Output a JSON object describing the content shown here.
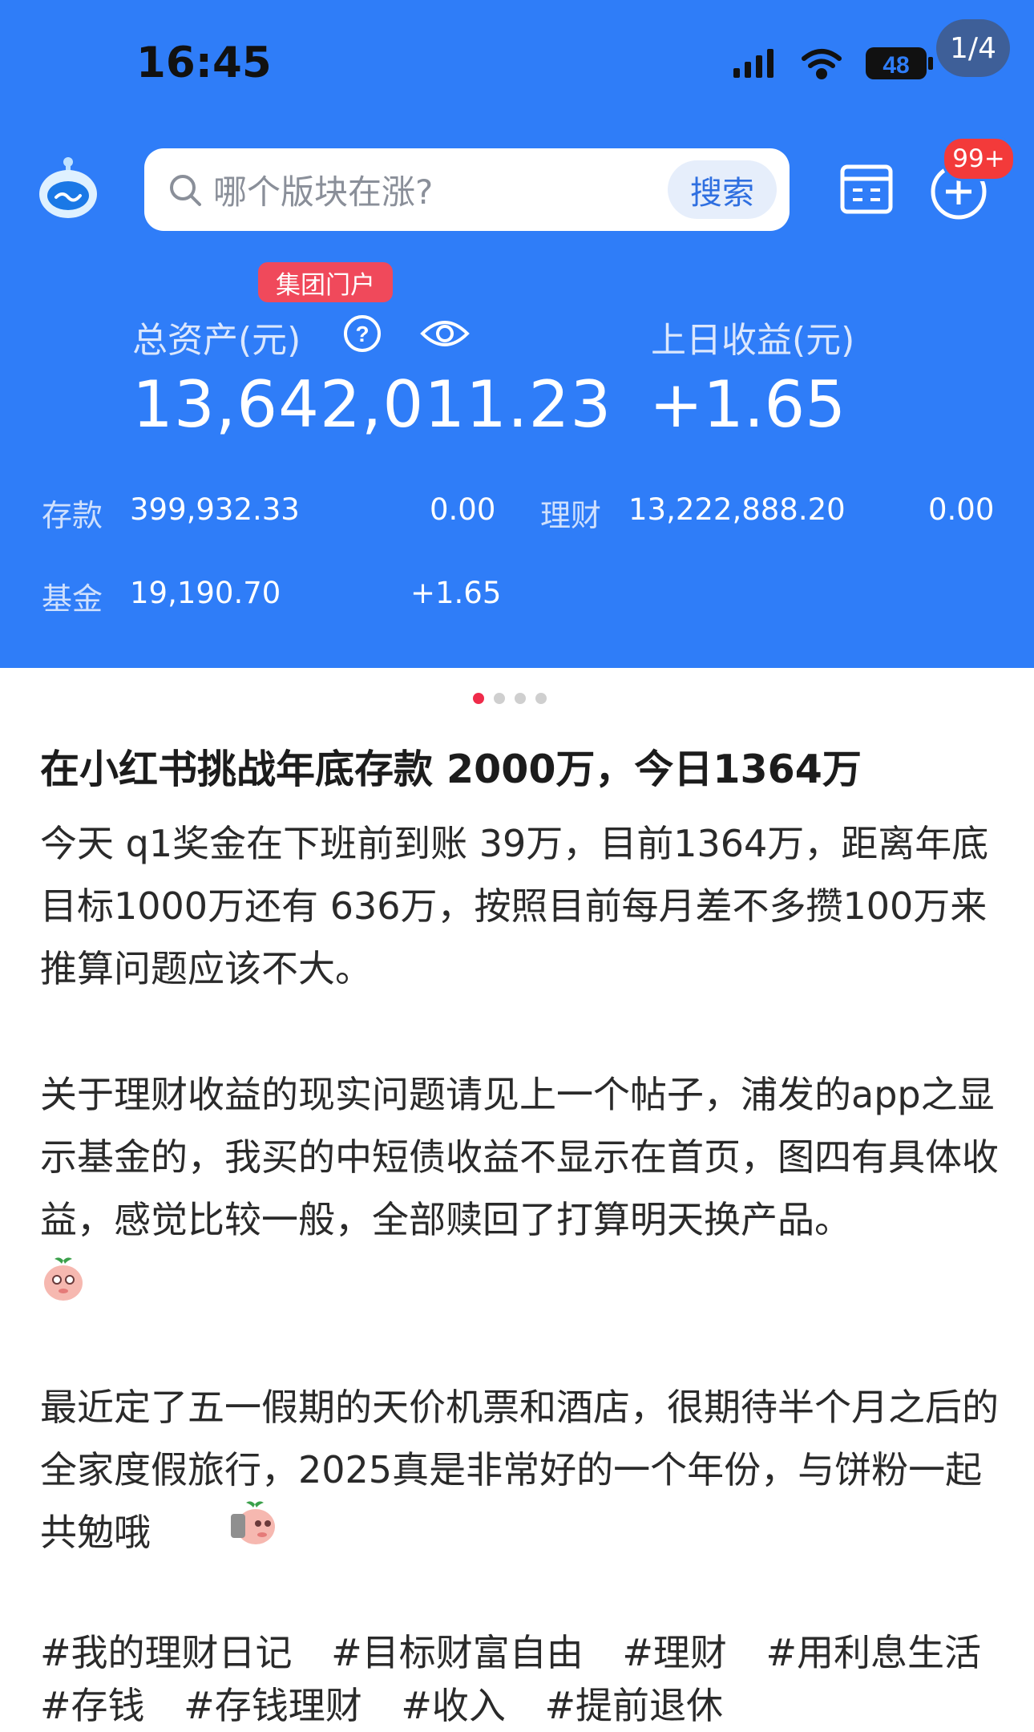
{
  "status_bar": {
    "time": "16:45",
    "battery": "48",
    "page_indicator": "1/4"
  },
  "header": {
    "search_placeholder": "哪个版块在涨?",
    "search_button": "搜索",
    "notification_badge": "99+"
  },
  "account": {
    "group_badge": "集团门户",
    "total_assets_label": "总资产(元)",
    "total_assets_value": "13,642,011.23",
    "yesterday_income_label": "上日收益(元)",
    "yesterday_income_value": "+1.65",
    "rows": [
      {
        "label": "存款",
        "value": "399,932.33",
        "change": "0.00"
      },
      {
        "label": "理财",
        "value": "13,222,888.20",
        "change": "0.00"
      },
      {
        "label": "基金",
        "value": "19,190.70",
        "change": "+1.65"
      }
    ]
  },
  "carousel": {
    "count": 4,
    "active": 0
  },
  "post": {
    "title": "在小红书挑战年底存款 2000万，今日1364万",
    "paragraphs": [
      "今天 q1奖金在下班前到账 39万，目前1364万，距离年底目标1000万还有 636万，按照目前每月差不多攒100万来推算问题应该不大。",
      "关于理财收益的现实问题请见上一个帖子，浦发的app之显示基金的，我买的中短债收益不显示在首页，图四有具体收益，感觉比较一般，全部赎回了打算明天换产品。",
      "最近定了五一假期的天价机票和酒店，很期待半个月之后的全家度假旅行，2025真是非常好的一个年份，与饼粉一起共勉哦"
    ],
    "tags": [
      "#我的理财日记",
      "#目标财富自由",
      "#理财",
      "#用利息生活",
      "#存钱",
      "#存钱理财",
      "#收入",
      "#提前退休"
    ]
  },
  "colors": {
    "brand_blue": "#2f7df8",
    "badge_red": "#f33a3a",
    "dot_active": "#ef2b4a"
  }
}
